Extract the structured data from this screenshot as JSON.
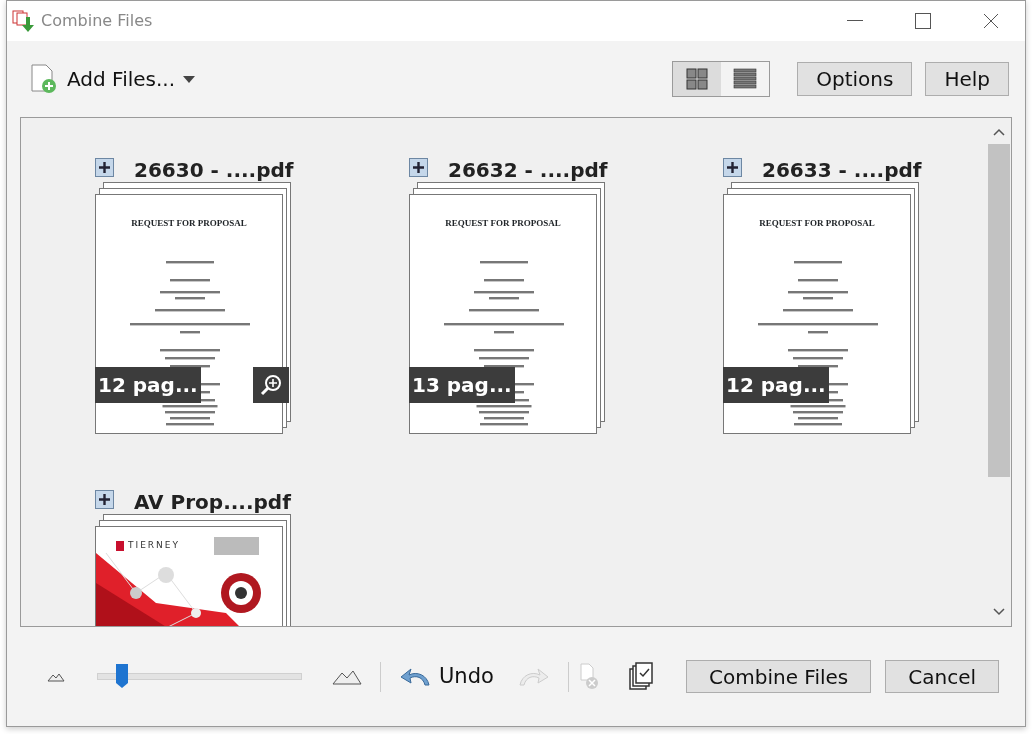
{
  "window": {
    "title": "Combine Files"
  },
  "toolbar": {
    "add_files": "Add Files...",
    "view_modes": [
      {
        "kind": "grid",
        "selected": true
      },
      {
        "kind": "list",
        "selected": false
      }
    ],
    "buttons": [
      "Options",
      "Help"
    ]
  },
  "files": [
    {
      "kind": "document",
      "name": "26630 - ....pdf",
      "pages": "12 pag...",
      "heading": "REQUEST FOR PROPOSAL",
      "zoom_shown": true
    },
    {
      "kind": "document",
      "name": "26632 - ....pdf",
      "pages": "13 pag...",
      "heading": "REQUEST FOR PROPOSAL",
      "zoom_shown": false
    },
    {
      "kind": "document",
      "name": "26633 - ....pdf",
      "pages": "12 pag...",
      "heading": "REQUEST FOR PROPOSAL",
      "zoom_shown": false
    },
    {
      "kind": "brochure",
      "name": "AV Prop....pdf",
      "logo": "TIERNEY"
    }
  ],
  "bottom": {
    "level": 0.12,
    "undo": "Undo",
    "redo_disabled": true,
    "remove_disabled": true,
    "buttons": [
      "Combine Files",
      "Cancel"
    ]
  }
}
